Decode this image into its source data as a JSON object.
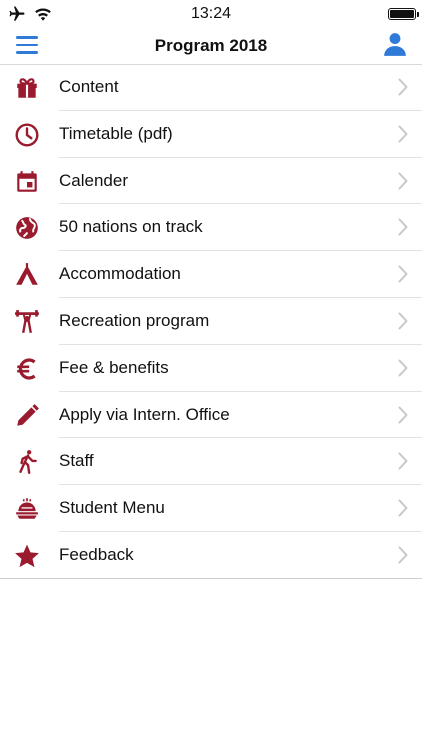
{
  "status_bar": {
    "time": "13:24"
  },
  "nav": {
    "title": "Program 2018"
  },
  "colors": {
    "accent": "#9a1b2e",
    "blue": "#2f7ad8",
    "chevron": "#c7c7cc"
  },
  "menu": [
    {
      "label": "Content",
      "icon": "gift-icon"
    },
    {
      "label": "Timetable (pdf)",
      "icon": "clock-icon"
    },
    {
      "label": "Calender",
      "icon": "calendar-icon"
    },
    {
      "label": "50 nations on track",
      "icon": "globe-icon"
    },
    {
      "label": "Accommodation",
      "icon": "tent-icon"
    },
    {
      "label": "Recreation program",
      "icon": "weightlifting-icon"
    },
    {
      "label": "Fee & benefits",
      "icon": "euro-icon"
    },
    {
      "label": "Apply via Intern. Office",
      "icon": "pencil-icon"
    },
    {
      "label": "Staff",
      "icon": "walking-person-icon"
    },
    {
      "label": "Student Menu",
      "icon": "food-dish-icon"
    },
    {
      "label": "Feedback",
      "icon": "star-icon"
    }
  ]
}
